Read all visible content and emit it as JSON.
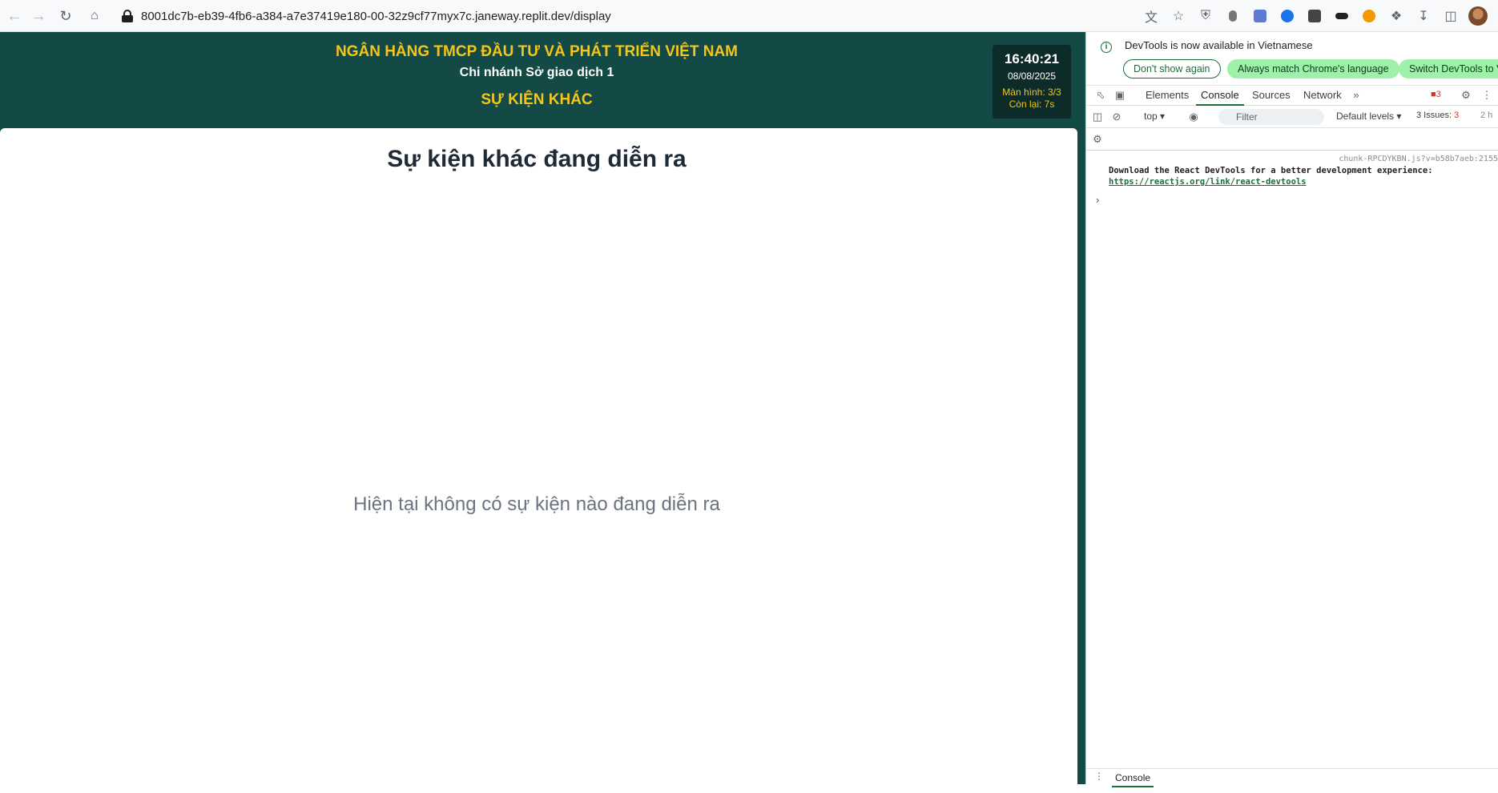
{
  "browser": {
    "url": "8001dc7b-eb39-4fb6-a384-a7e37419e180-00-32z9cf77myx7c.janeway.replit.dev/display"
  },
  "header": {
    "bank_name": "NGÂN HÀNG TMCP ĐẦU TƯ VÀ PHÁT TRIỂN VIỆT NAM",
    "branch": "Chi nhánh Sở giao dịch 1",
    "section": "SỰ KIỆN KHÁC"
  },
  "clock": {
    "time": "16:40:21",
    "date": "08/08/2025",
    "screen": "Màn hình: 3/3",
    "remaining": "Còn lại: 7s"
  },
  "main": {
    "title": "Sự kiện khác đang diễn ra",
    "empty_message": "Hiện tại không có sự kiện nào đang diễn ra"
  },
  "devtools": {
    "notice": "DevTools is now available in Vietnamese",
    "btn_dont_show": "Don't show again",
    "btn_match": "Always match Chrome's language",
    "btn_switch": "Switch DevTools to V",
    "tabs": [
      "Elements",
      "Console",
      "Sources",
      "Network"
    ],
    "error_count": "3",
    "context": "top",
    "filter_placeholder": "Filter",
    "levels": "Default levels",
    "issues": "3 Issues:",
    "issues_count": "3",
    "hidden": "2 h",
    "source": "chunk-RPCDYKBN.js?v=b58b7aeb:2155",
    "message": "Download the React DevTools for a better development experience:",
    "link": "https://reactjs.org/link/react-devtools",
    "drawer_tab": "Console"
  },
  "colors": {
    "header_bg": "#134a45",
    "accent_yellow": "#f5c518",
    "devtools_green": "#1b6e3a"
  }
}
